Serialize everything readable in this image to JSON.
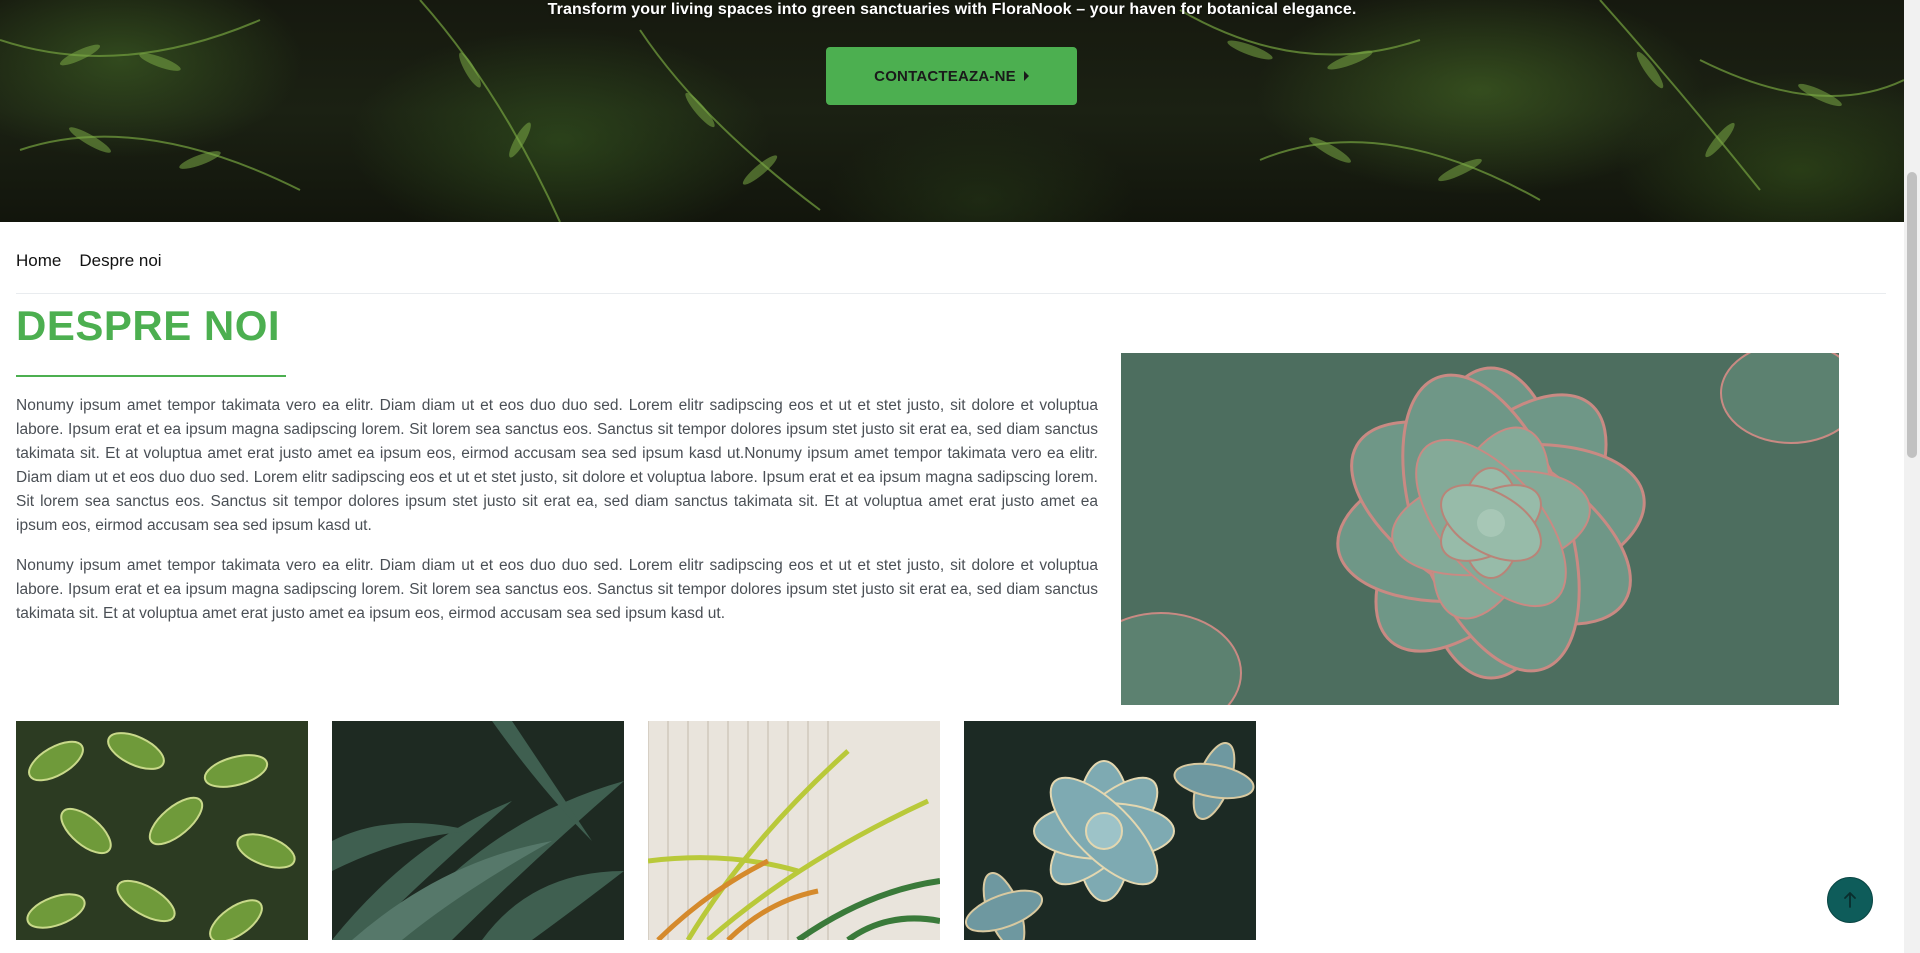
{
  "hero": {
    "tagline": "Transform your living spaces into green sanctuaries with FloraNook – your haven for botanical elegance.",
    "cta_label": "CONTACTEAZA-NE"
  },
  "breadcrumb": {
    "items": [
      "Home",
      "Despre noi"
    ]
  },
  "about": {
    "title": "DESPRE NOI",
    "paragraphs": [
      "Nonumy ipsum amet tempor takimata vero ea elitr. Diam diam ut et eos duo duo sed. Lorem elitr sadipscing eos et ut et stet justo, sit dolore et voluptua labore. Ipsum erat et ea ipsum magna sadipscing lorem. Sit lorem sea sanctus eos. Sanctus sit tempor dolores ipsum stet justo sit erat ea, sed diam sanctus takimata sit. Et at voluptua amet erat justo amet ea ipsum eos, eirmod accusam sea sed ipsum kasd ut.Nonumy ipsum amet tempor takimata vero ea elitr. Diam diam ut et eos duo duo sed. Lorem elitr sadipscing eos et ut et stet justo, sit dolore et voluptua labore. Ipsum erat et ea ipsum magna sadipscing lorem. Sit lorem sea sanctus eos. Sanctus sit tempor dolores ipsum stet justo sit erat ea, sed diam sanctus takimata sit. Et at voluptua amet erat justo amet ea ipsum eos, eirmod accusam sea sed ipsum kasd ut.",
      "Nonumy ipsum amet tempor takimata vero ea elitr. Diam diam ut et eos duo duo sed. Lorem elitr sadipscing eos et ut et stet justo, sit dolore et voluptua labore. Ipsum erat et ea ipsum magna sadipscing lorem. Sit lorem sea sanctus eos. Sanctus sit tempor dolores ipsum stet justo sit erat ea, sed diam sanctus takimata sit. Et at voluptua amet erat justo amet ea ipsum eos, eirmod accusam sea sed ipsum kasd ut."
    ]
  },
  "gallery": {
    "items": [
      "variegated-leaves",
      "aloe-plants",
      "palm-fronds",
      "blue-succulents"
    ]
  },
  "icons": {
    "cta": "caret-right-icon",
    "scroll_top": "arrow-up-icon"
  },
  "colors": {
    "accent": "#4caf50",
    "scroll_top_bg": "#0e5c5a",
    "body_text": "#4a4f55"
  }
}
